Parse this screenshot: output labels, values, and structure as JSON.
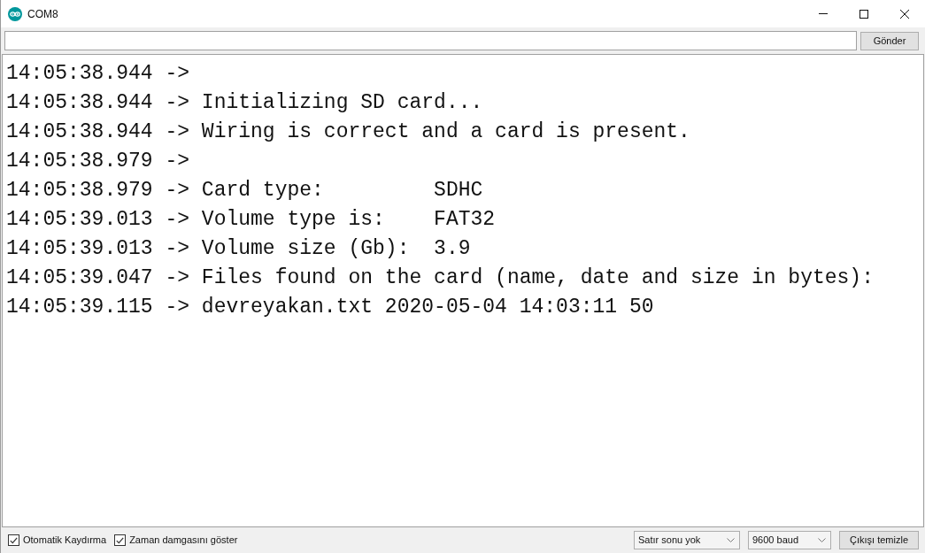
{
  "window": {
    "title": "COM8"
  },
  "send_bar": {
    "button": "Gönder"
  },
  "output": {
    "lines": [
      "14:05:38.944 ->",
      "14:05:38.944 -> Initializing SD card...",
      "14:05:38.944 -> Wiring is correct and a card is present.",
      "14:05:38.979 ->",
      "14:05:38.979 -> Card type:         SDHC",
      "14:05:39.013 -> Volume type is:    FAT32",
      "14:05:39.013 -> Volume size (Gb):  3.9",
      "14:05:39.047 -> Files found on the card (name, date and size in bytes):",
      "14:05:39.115 -> devreyakan.txt 2020-05-04 14:03:11 50"
    ]
  },
  "footer": {
    "checkboxes": [
      {
        "label": "Otomatik Kaydırma",
        "checked": true
      },
      {
        "label": "Zaman damgasını göster",
        "checked": true
      }
    ],
    "line_ending": {
      "value": "Satır sonu yok"
    },
    "baud_rate": {
      "value": "9600 baud"
    },
    "clear_button": "Çıkışı temizle"
  }
}
